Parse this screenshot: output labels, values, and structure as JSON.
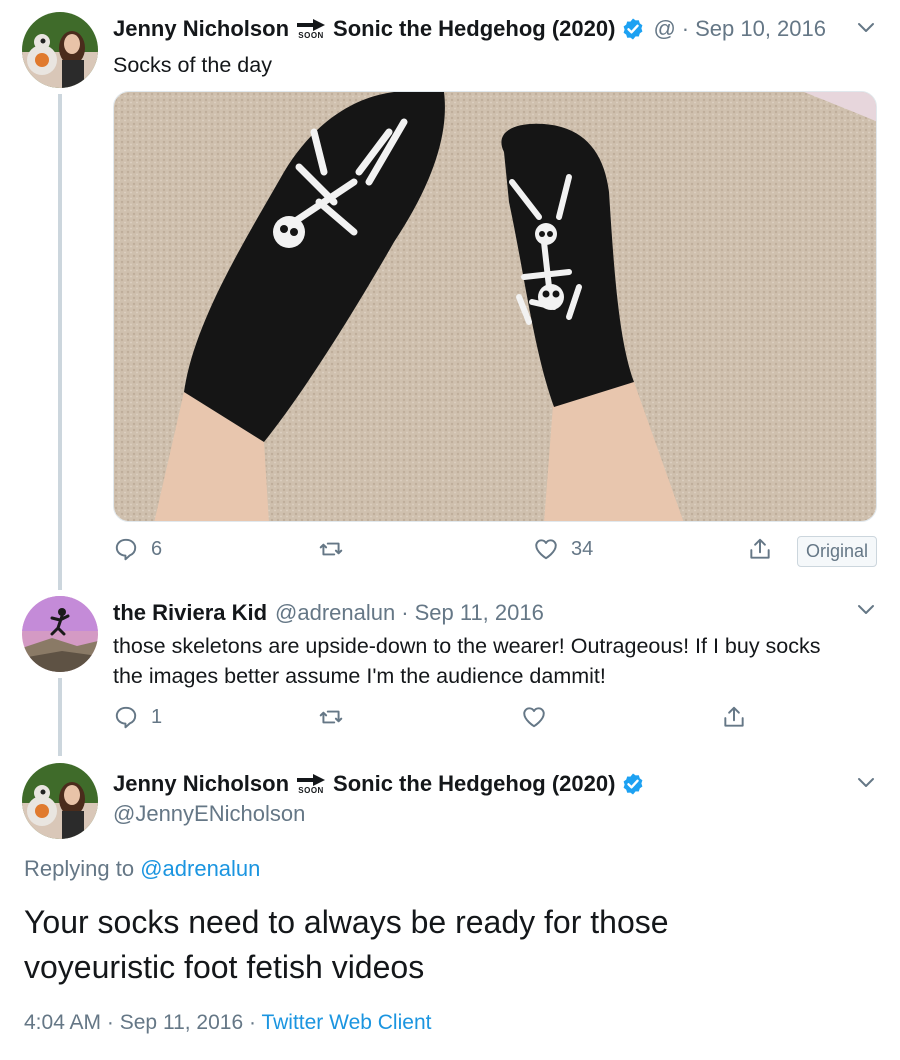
{
  "tweet1": {
    "author_name": "Jenny Nicholson",
    "soon_label": "SOON",
    "author_suffix": "Sonic the Hedgehog (2020)",
    "handle": "@",
    "separator": "·",
    "date": "Sep 10, 2016",
    "text": "Socks of the day",
    "reply_count": "6",
    "retweet_count": "",
    "like_count": "34",
    "original_button": "Original"
  },
  "tweet2": {
    "author_name": "the Riviera Kid",
    "handle": "@adrenalun",
    "separator": "·",
    "date": "Sep 11, 2016",
    "text_line1": "those skeletons are upside-down to the wearer! Outrageous! If I buy socks",
    "text_line2": "the images better assume I'm the audience dammit!",
    "reply_count": "1"
  },
  "tweet3": {
    "author_name": "Jenny Nicholson",
    "soon_label": "SOON",
    "author_suffix": "Sonic the Hedgehog (2020)",
    "handle": "@JennyENicholson",
    "replying_prefix": "Replying to",
    "replying_handle": "@adrenalun",
    "text_line1": "Your socks need to always be ready for those",
    "text_line2": "voyeuristic foot fetish videos",
    "time": "4:04 AM",
    "separator": "·",
    "date": "Sep 11, 2016",
    "client": "Twitter Web Client"
  },
  "colors": {
    "link": "#1b95e0",
    "verified": "#1da1f2",
    "muted": "#657786",
    "thread_line": "#ccd6dd"
  },
  "icons": [
    "chevron-down-icon",
    "verified-badge-icon",
    "soon-arrow-icon",
    "reply-icon",
    "retweet-icon",
    "like-icon",
    "share-icon"
  ]
}
